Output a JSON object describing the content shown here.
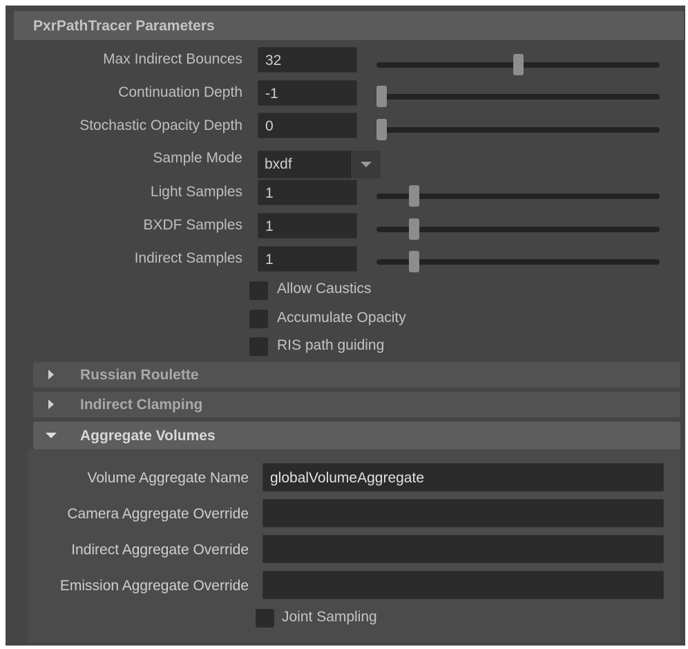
{
  "panel": {
    "title": "PxrPathTracer Parameters"
  },
  "params": {
    "max_indirect_bounces": {
      "label": "Max Indirect Bounces",
      "value": "32",
      "slider_fraction": 0.5
    },
    "continuation_depth": {
      "label": "Continuation Depth",
      "value": "-1",
      "slider_fraction": 0.0
    },
    "stochastic_opacity_depth": {
      "label": "Stochastic Opacity Depth",
      "value": "0",
      "slider_fraction": 0.0
    },
    "sample_mode": {
      "label": "Sample Mode",
      "value": "bxdf"
    },
    "light_samples": {
      "label": "Light Samples",
      "value": "1",
      "slider_fraction": 0.12
    },
    "bxdf_samples": {
      "label": "BXDF Samples",
      "value": "1",
      "slider_fraction": 0.12
    },
    "indirect_samples": {
      "label": "Indirect Samples",
      "value": "1",
      "slider_fraction": 0.12
    }
  },
  "checkboxes": {
    "allow_caustics": {
      "label": "Allow Caustics",
      "checked": false
    },
    "accumulate_opacity": {
      "label": "Accumulate Opacity",
      "checked": false
    },
    "ris_path_guiding": {
      "label": "RIS path guiding",
      "checked": false
    }
  },
  "sections": {
    "russian_roulette": {
      "title": "Russian Roulette",
      "expanded": false
    },
    "indirect_clamping": {
      "title": "Indirect Clamping",
      "expanded": false
    },
    "aggregate_volumes": {
      "title": "Aggregate Volumes",
      "expanded": true
    }
  },
  "aggregate_volumes": {
    "volume_aggregate_name": {
      "label": "Volume Aggregate Name",
      "value": "globalVolumeAggregate"
    },
    "camera_aggregate_override": {
      "label": "Camera Aggregate Override",
      "value": ""
    },
    "indirect_aggregate_override": {
      "label": "Indirect Aggregate Override",
      "value": ""
    },
    "emission_aggregate_override": {
      "label": "Emission Aggregate Override",
      "value": ""
    },
    "joint_sampling": {
      "label": "Joint Sampling",
      "checked": false
    }
  },
  "colors": {
    "panel_bg": "#454545",
    "field_bg": "#2b2b2b",
    "slider_thumb": "#8d8d8d"
  }
}
